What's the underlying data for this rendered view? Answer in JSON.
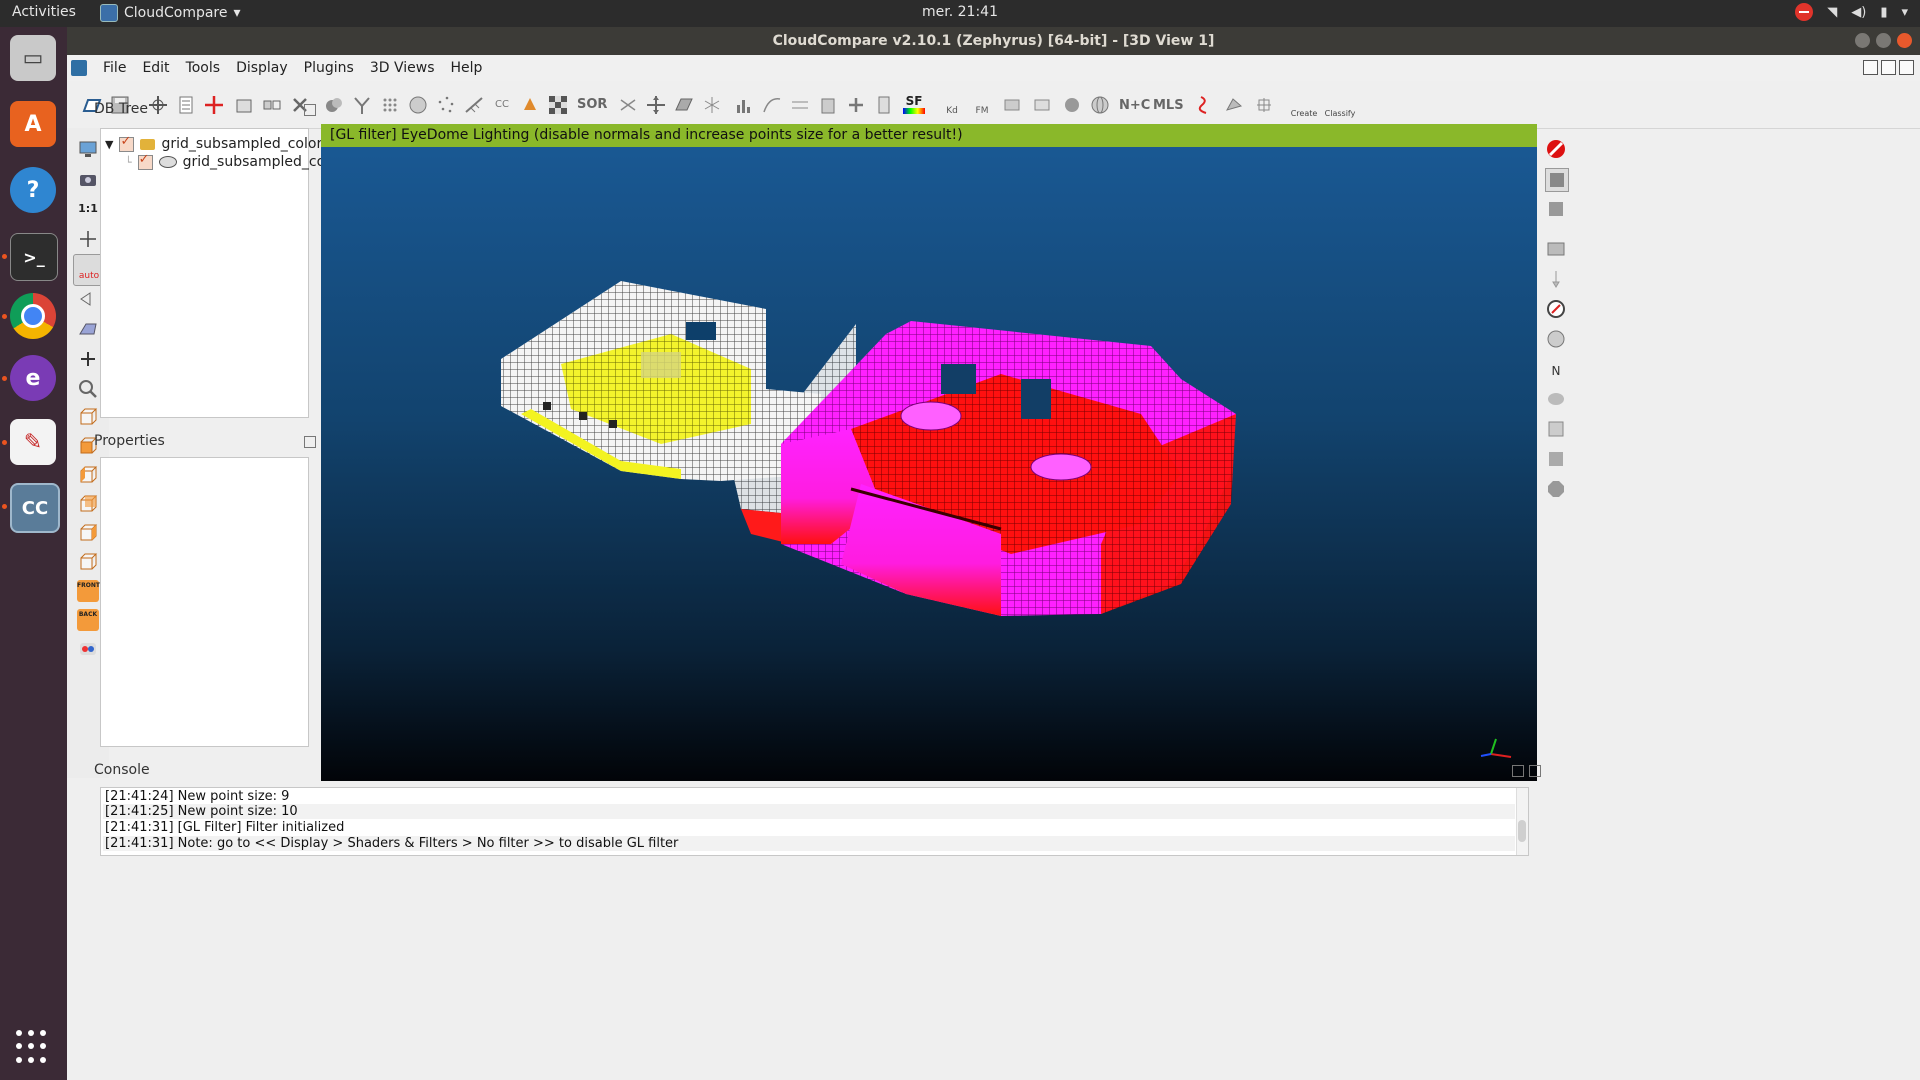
{
  "system_bar": {
    "activities": "Activities",
    "app_menu_label": "CloudCompare",
    "clock": "mer. 21:41"
  },
  "window": {
    "title": "CloudCompare v2.10.1 (Zephyrus) [64-bit] - [3D View 1]"
  },
  "menu": [
    "File",
    "Edit",
    "Tools",
    "Display",
    "Plugins",
    "3D Views",
    "Help"
  ],
  "toolbar_icons": [
    "open-icon",
    "save-icon",
    "translate-rotate-icon",
    "list-icon",
    "point-pick-icon",
    "crop-icon",
    "segment-icon",
    "delete-icon",
    "clone-icon",
    "merge-icon",
    "sample-icon",
    "subsample-icon",
    "noise-icon",
    "normals-icon",
    "cc-icon",
    "color-icon",
    "checker-icon",
    "sor-icon"
  ],
  "toolbar_text_icons": {
    "cc": "CC",
    "sor": "SOR",
    "sf": "SF",
    "kd": "Kd",
    "fm": "FM",
    "nc": "N+C",
    "mls": "MLS",
    "canupo_create": "Create",
    "canupo_classify": "Classify"
  },
  "left_tools": {
    "one_to_one": "1:1",
    "auto": "auto",
    "front": "FRONT",
    "back": "BACK"
  },
  "db_tree": {
    "title": "DB Tree",
    "items": [
      {
        "label": "grid_subsampled_colors...",
        "type": "folder",
        "checked": true,
        "expanded": true
      },
      {
        "label": "grid_subsampled_col...",
        "type": "cloud",
        "checked": true
      }
    ]
  },
  "properties": {
    "title": "Properties"
  },
  "view3d": {
    "banner": "[GL filter] EyeDome Lighting (disable normals and increase points size for a better result!)",
    "banner_color": "#8ab82a"
  },
  "right_tools": {
    "north": "N"
  },
  "console": {
    "title": "Console",
    "lines": [
      "[21:41:24] New point size: 9",
      "[21:41:25] New point size: 10",
      "[21:41:31] [GL Filter] Filter initialized",
      "[21:41:31] Note: go to << Display > Shaders & Filters > No filter >> to disable GL filter"
    ]
  },
  "colors": {
    "accent": "#e95420",
    "dock_bg": "#3b2a36",
    "magenta_points": "#ff1cff",
    "red_points": "#ff1a1a",
    "yellow_points": "#f3f321",
    "white_points": "#f2f2f2"
  }
}
